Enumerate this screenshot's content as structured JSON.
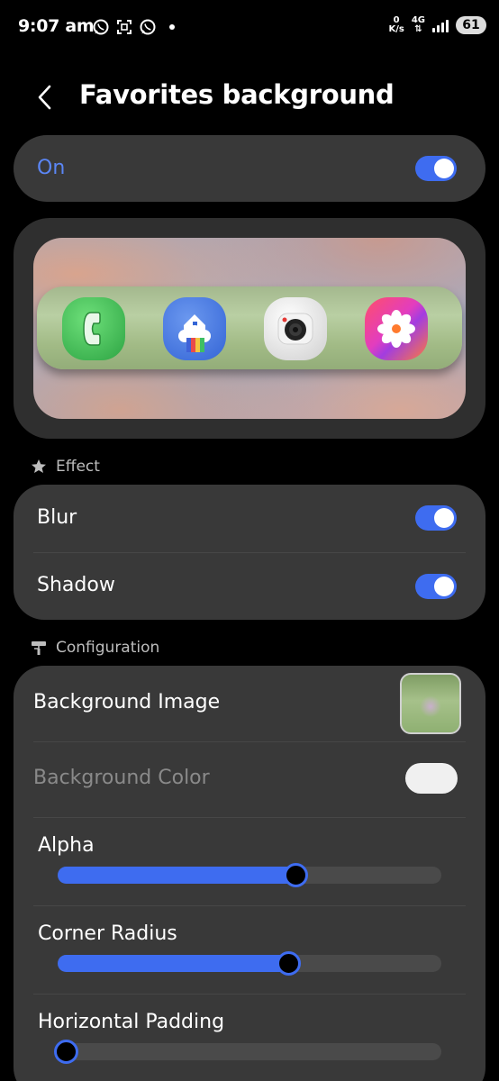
{
  "status_bar": {
    "time": "9:07 am",
    "speed_value": "0",
    "speed_unit": "K/s",
    "network": "4G",
    "battery": "61"
  },
  "header": {
    "title": "Favorites background"
  },
  "master_switch": {
    "label": "On",
    "enabled": true
  },
  "preview": {
    "apps": [
      "phone-icon",
      "smartthings-icon",
      "camera-icon",
      "gallery-icon"
    ]
  },
  "effect": {
    "section_title": "Effect",
    "items": [
      {
        "label": "Blur",
        "enabled": true
      },
      {
        "label": "Shadow",
        "enabled": true
      }
    ]
  },
  "configuration": {
    "section_title": "Configuration",
    "background_image_label": "Background Image",
    "background_color_label": "Background Color",
    "sliders": [
      {
        "label": "Alpha",
        "value": 0.62
      },
      {
        "label": "Corner Radius",
        "value": 0.6
      },
      {
        "label": "Horizontal Padding",
        "value": 0.02
      }
    ]
  },
  "colors": {
    "accent": "#3e6cf0",
    "card": "#393939",
    "on_label": "#5b86f5",
    "disabled_text": "#8a8a8a"
  }
}
